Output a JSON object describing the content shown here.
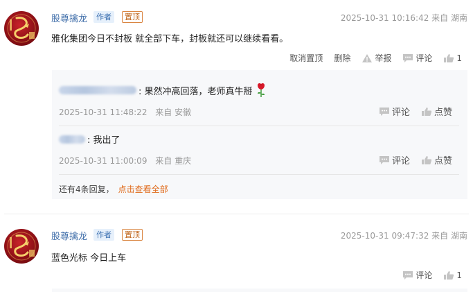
{
  "posts": [
    {
      "username": "股尊擒龙",
      "author_tag": "作者",
      "pinned_tag": "置顶",
      "time": "2025-10-31 10:16:42",
      "location": "来自 湖南",
      "content": "雅化集团今日不封板 就全部下车，封板就还可以继续看看。",
      "actions": {
        "unpin": "取消置顶",
        "delete": "删除",
        "report": "举报",
        "comment": "评论",
        "likes": "1"
      },
      "replies": [
        {
          "text": ": 果然冲高回落，老师真牛掰",
          "time": "2025-10-31 11:48:22",
          "location": "来自 安徽",
          "comment": "评论",
          "like": "点赞"
        },
        {
          "text": ": 我出了",
          "time": "2025-10-31 11:00:09",
          "location": "来自 重庆",
          "comment": "评论",
          "like": "点赞"
        }
      ],
      "more_text": "还有4条回复，",
      "more_link": "点击查看全部"
    },
    {
      "username": "股尊擒龙",
      "author_tag": "作者",
      "pinned_tag": "置顶",
      "time": "2025-10-31 09:47:32",
      "location": "来自 湖南",
      "content": "蓝色光标 今日上车",
      "actions": {
        "comment": "评论",
        "likes": "1"
      }
    }
  ],
  "colors": {
    "username": "#3d6ca8",
    "pin_tag": "#c0651a",
    "link": "#e06a1b"
  }
}
